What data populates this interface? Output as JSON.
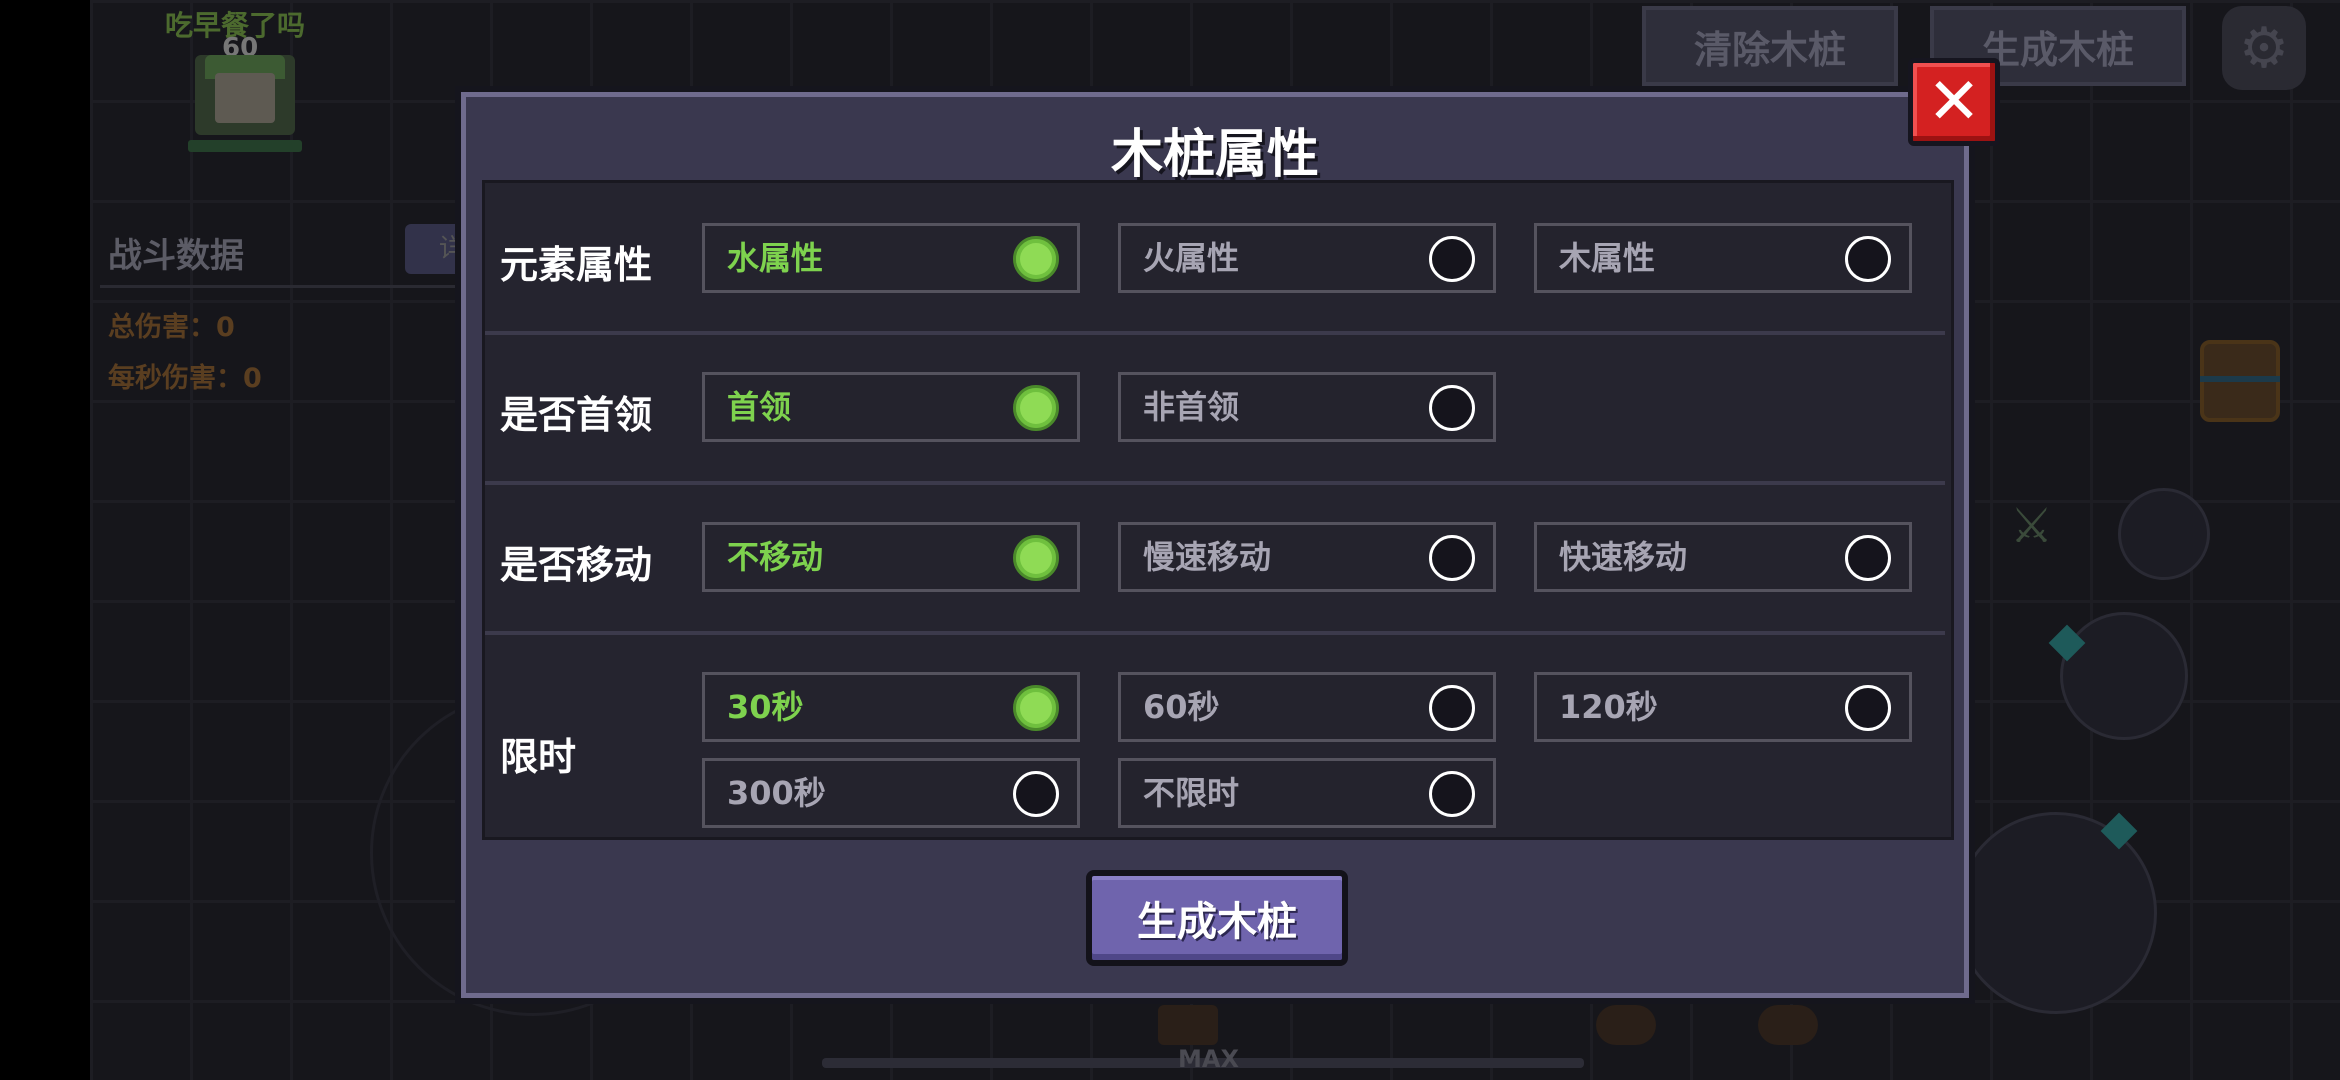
{
  "player": {
    "name": "吃早餐了吗",
    "level": "60"
  },
  "battle": {
    "title": "战斗数据",
    "tab_label": "详",
    "total_damage": "总伤害：0",
    "dps": "每秒伤害：0"
  },
  "top_buttons": {
    "clear": "清除木桩",
    "spawn": "生成木桩"
  },
  "bottom": {
    "max_label": "MAX"
  },
  "dialog": {
    "title": "木桩属性",
    "close_label": "✕",
    "generate_label": "生成木桩",
    "rows": [
      {
        "label": "元素属性",
        "options": [
          {
            "label": "水属性",
            "selected": true
          },
          {
            "label": "火属性",
            "selected": false
          },
          {
            "label": "木属性",
            "selected": false
          }
        ]
      },
      {
        "label": "是否首领",
        "options": [
          {
            "label": "首领",
            "selected": true
          },
          {
            "label": "非首领",
            "selected": false
          }
        ]
      },
      {
        "label": "是否移动",
        "options": [
          {
            "label": "不移动",
            "selected": true
          },
          {
            "label": "慢速移动",
            "selected": false
          },
          {
            "label": "快速移动",
            "selected": false
          }
        ]
      },
      {
        "label": "限时",
        "options": [
          {
            "label": "30秒",
            "selected": true
          },
          {
            "label": "60秒",
            "selected": false
          },
          {
            "label": "120秒",
            "selected": false
          },
          {
            "label": "300秒",
            "selected": false
          },
          {
            "label": "不限时",
            "selected": false
          }
        ]
      }
    ]
  },
  "colors": {
    "selected_text": "#7ed24e",
    "close_red": "#d42121",
    "generate_purple": "#6f64ad"
  }
}
